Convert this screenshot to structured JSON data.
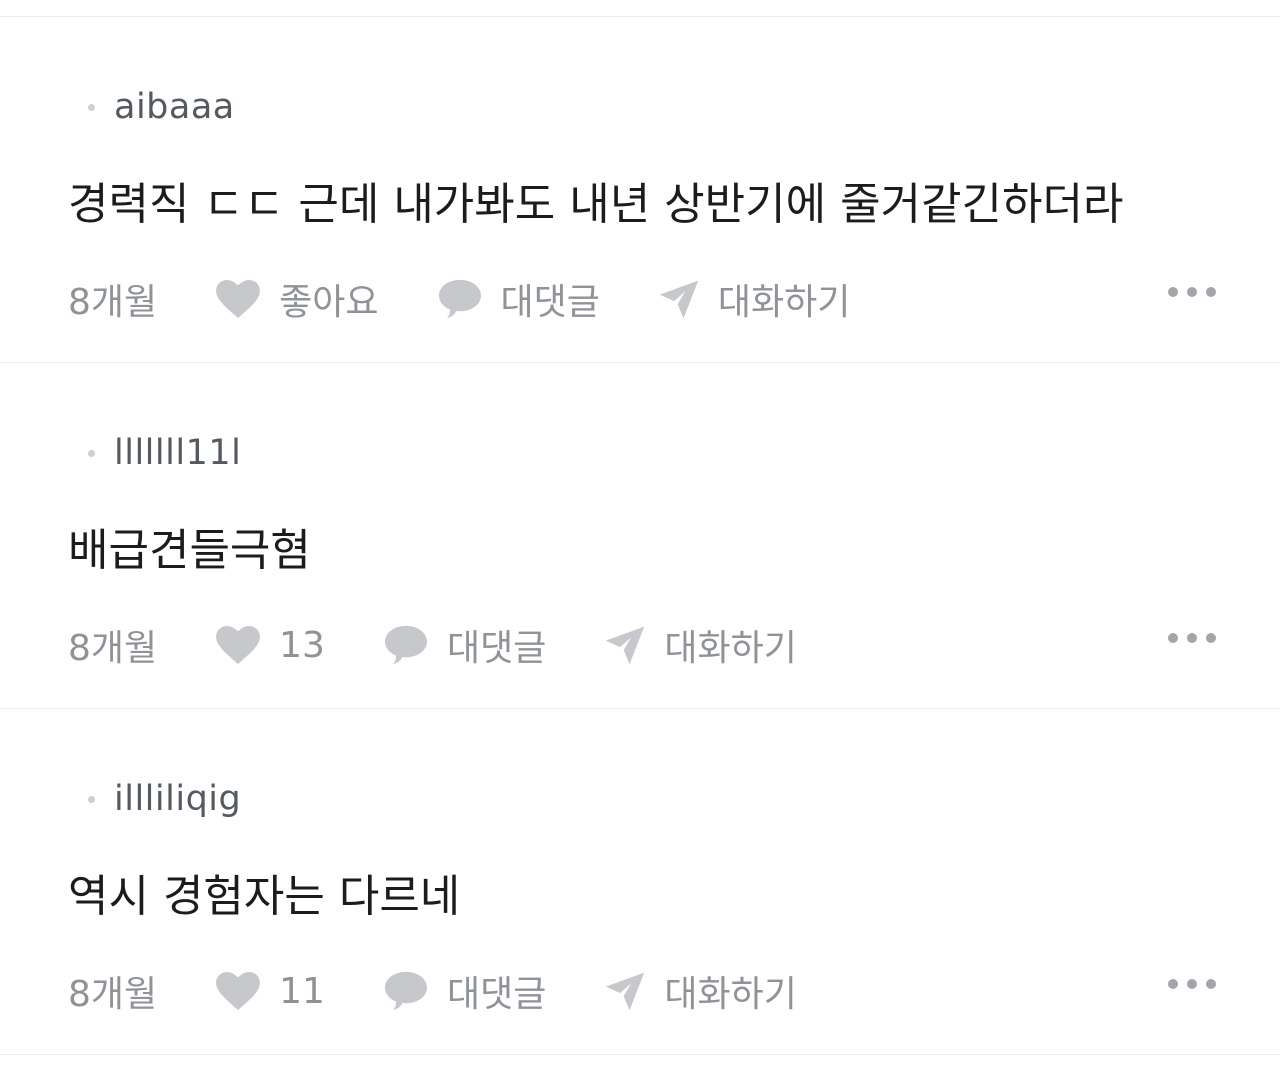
{
  "colors": {
    "author": "#555a61",
    "body": "#1c1c1c",
    "meta": "#8f9297",
    "icon": "#c6c8cc",
    "divider": "#ececec"
  },
  "comments": [
    {
      "author": "aibaaa",
      "text": "경력직 ㄷㄷ 근데 내가봐도 내년 상반기에 줄거같긴하더라",
      "time": "8개월",
      "like_label": "좋아요",
      "reply_label": "대댓글",
      "chat_label": "대화하기"
    },
    {
      "author": "lllllll11l",
      "text": "배급견들극혐",
      "time": "8개월",
      "like_label": "13",
      "reply_label": "대댓글",
      "chat_label": "대화하기"
    },
    {
      "author": "illliliqig",
      "text": "역시 경험자는 다르네",
      "time": "8개월",
      "like_label": "11",
      "reply_label": "대댓글",
      "chat_label": "대화하기"
    }
  ],
  "icons": {
    "like": "heart-icon",
    "reply": "speech-bubble-icon",
    "chat": "paper-plane-icon",
    "more": "more-dots-icon"
  }
}
